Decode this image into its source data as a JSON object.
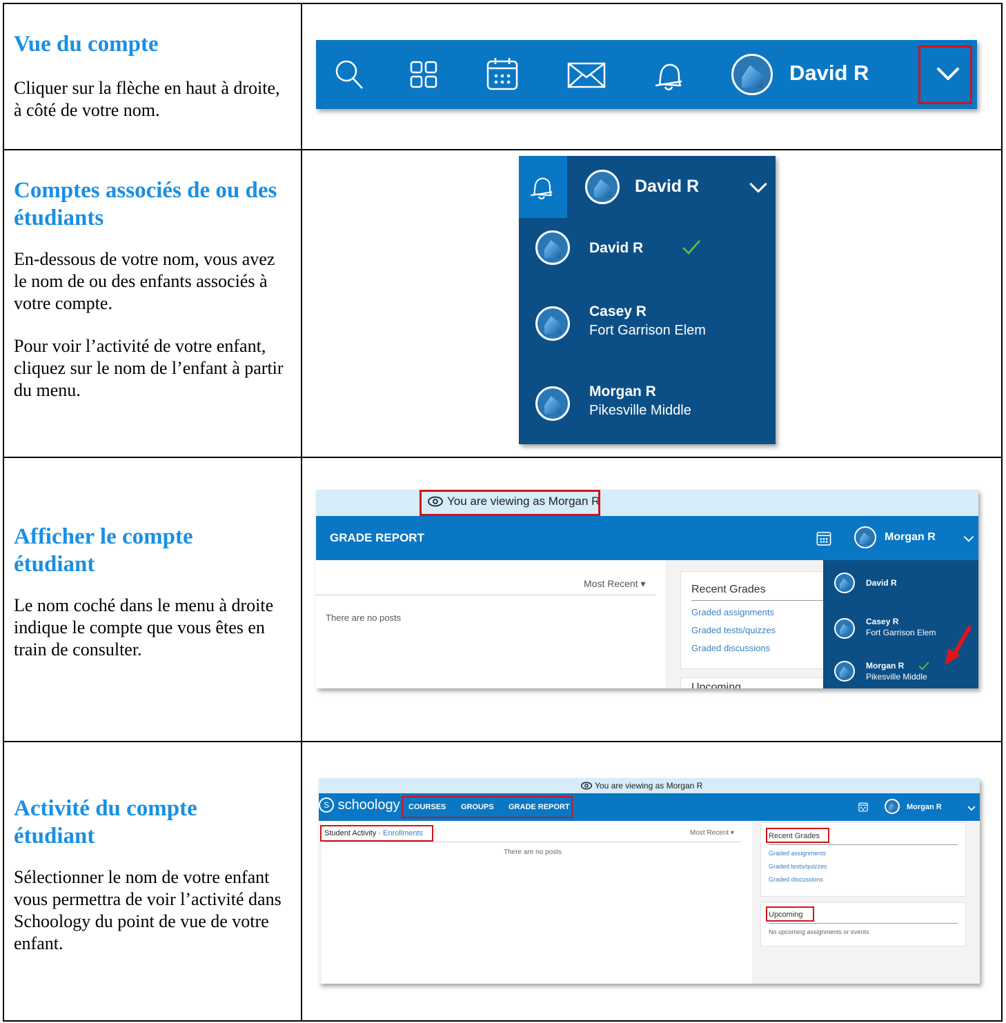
{
  "rows": [
    {
      "heading": "Vue du compte",
      "text": "Cliquer sur la flèche en haut à droite, à côté de votre nom."
    },
    {
      "heading": "Comptes associés de ou des étudiants",
      "text1": "En-dessous de votre nom, vous avez le nom de ou des enfants associés à votre compte.",
      "text2": "Pour voir l’activité de votre enfant, cliquez sur le nom de l’enfant à partir du menu."
    },
    {
      "heading": "Afficher le compte étudiant",
      "text": "Le nom coché dans le menu à droite indique le compte que vous êtes en train de consulter."
    },
    {
      "heading": "Activité du compte étudiant",
      "text": "Sélectionner le nom de votre enfant vous permettra de voir l’activité dans Schoology du point de vue de votre enfant."
    }
  ],
  "shot1": {
    "user_name": "David R",
    "icons": [
      "search-icon",
      "apps-grid-icon",
      "calendar-icon",
      "mail-icon",
      "bell-icon",
      "avatar",
      "chevron-down-icon"
    ]
  },
  "shot2": {
    "header_name": "David R",
    "accounts": [
      {
        "name": "David R",
        "school": "",
        "selected": true
      },
      {
        "name": "Casey R",
        "school": "Fort Garrison Elem",
        "selected": false
      },
      {
        "name": "Morgan R",
        "school": "Pikesville Middle",
        "selected": false
      }
    ]
  },
  "shot3": {
    "viewing_banner": "You are viewing as Morgan R",
    "page_title": "GRADE REPORT",
    "header_name": "Morgan R",
    "sort_label": "Most Recent",
    "empty_text": "There are no posts",
    "recent_grades_title": "Recent Grades",
    "links": [
      "Graded assignments",
      "Graded tests/quizzes",
      "Graded discussions"
    ],
    "upcoming_title": "Upcoming",
    "accounts": [
      {
        "name": "David R",
        "school": ""
      },
      {
        "name": "Casey R",
        "school": "Fort Garrison Elem"
      },
      {
        "name": "Morgan R",
        "school": "Pikesville Middle"
      }
    ]
  },
  "shot4": {
    "viewing_banner": "You are viewing as Morgan R",
    "brand": "schoology",
    "nav": [
      "COURSES",
      "GROUPS",
      "GRADE REPORT"
    ],
    "header_name": "Morgan R",
    "activity_label": "Student Activity · ",
    "enrollments_link": "Enrollments",
    "sort_label": "Most Recent",
    "empty_text": "There are no posts",
    "recent_grades_title": "Recent Grades",
    "links": [
      "Graded assignments",
      "Graded tests/quizzes",
      "Graded discussions"
    ],
    "upcoming_title": "Upcoming",
    "upcoming_empty": "No upcoming assignments or events"
  },
  "colors": {
    "heading": "#1a8fe3",
    "bar_blue": "#0a77c4",
    "menu_dark": "#0c4f86",
    "highlight_red": "#d0141a",
    "check_green": "#6abf3c"
  }
}
